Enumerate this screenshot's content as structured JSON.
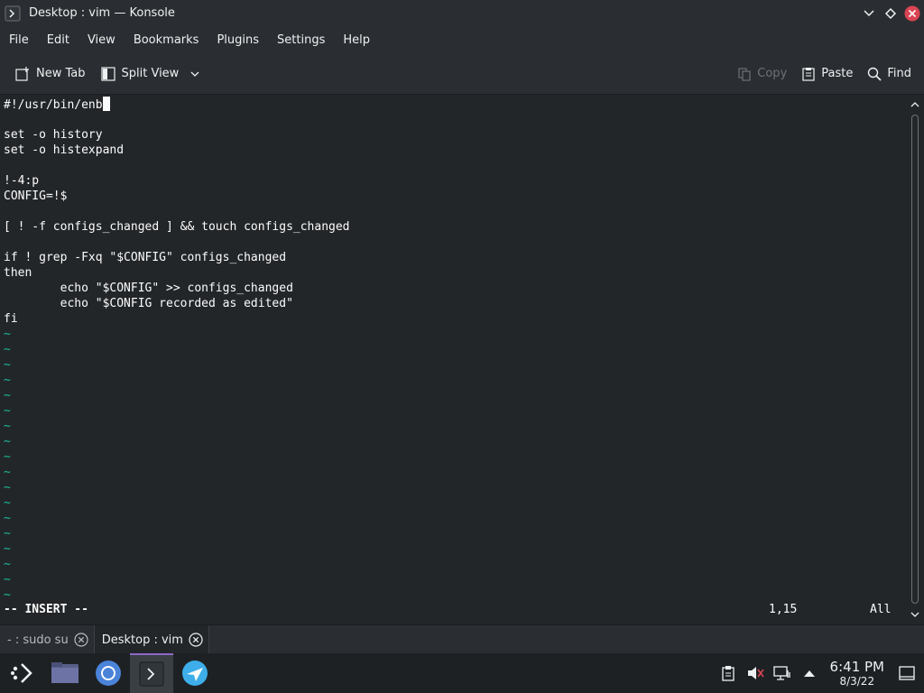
{
  "window": {
    "title": "Desktop : vim — Konsole"
  },
  "menu": {
    "items": [
      "File",
      "Edit",
      "View",
      "Bookmarks",
      "Plugins",
      "Settings",
      "Help"
    ]
  },
  "toolbar": {
    "new_tab": "New Tab",
    "split_view": "Split View",
    "copy": "Copy",
    "paste": "Paste",
    "find": "Find"
  },
  "terminal": {
    "lines": [
      "#!/usr/bin/enb",
      "",
      "set -o history",
      "set -o histexpand",
      "",
      "!-4:p",
      "CONFIG=!$",
      "",
      "[ ! -f configs_changed ] && touch configs_changed",
      "",
      "if ! grep -Fxq \"$CONFIG\" configs_changed",
      "then",
      "        echo \"$CONFIG\" >> configs_changed",
      "        echo \"$CONFIG recorded as edited\"",
      "fi"
    ],
    "tilde": "~",
    "tilde_count": 18,
    "mode": "-- INSERT --",
    "cursor_position": "1,15",
    "scroll_position": "All",
    "colors": {
      "text": "#fcfcfc",
      "tilde": "#1abc9c",
      "background": "#232629"
    }
  },
  "tabs": [
    {
      "label": "- : sudo su",
      "active": false
    },
    {
      "label": "Desktop : vim",
      "active": true
    }
  ],
  "taskbar": {
    "apps": [
      {
        "icon": "app-launcher-icon",
        "active": false
      },
      {
        "icon": "file-manager-icon",
        "active": false
      },
      {
        "icon": "chromium-icon",
        "active": false
      },
      {
        "icon": "konsole-icon",
        "active": true
      },
      {
        "icon": "discover-icon",
        "active": false
      }
    ],
    "clock": {
      "time": "6:41 PM",
      "date": "8/3/22"
    },
    "accent": "#8e68c7"
  }
}
